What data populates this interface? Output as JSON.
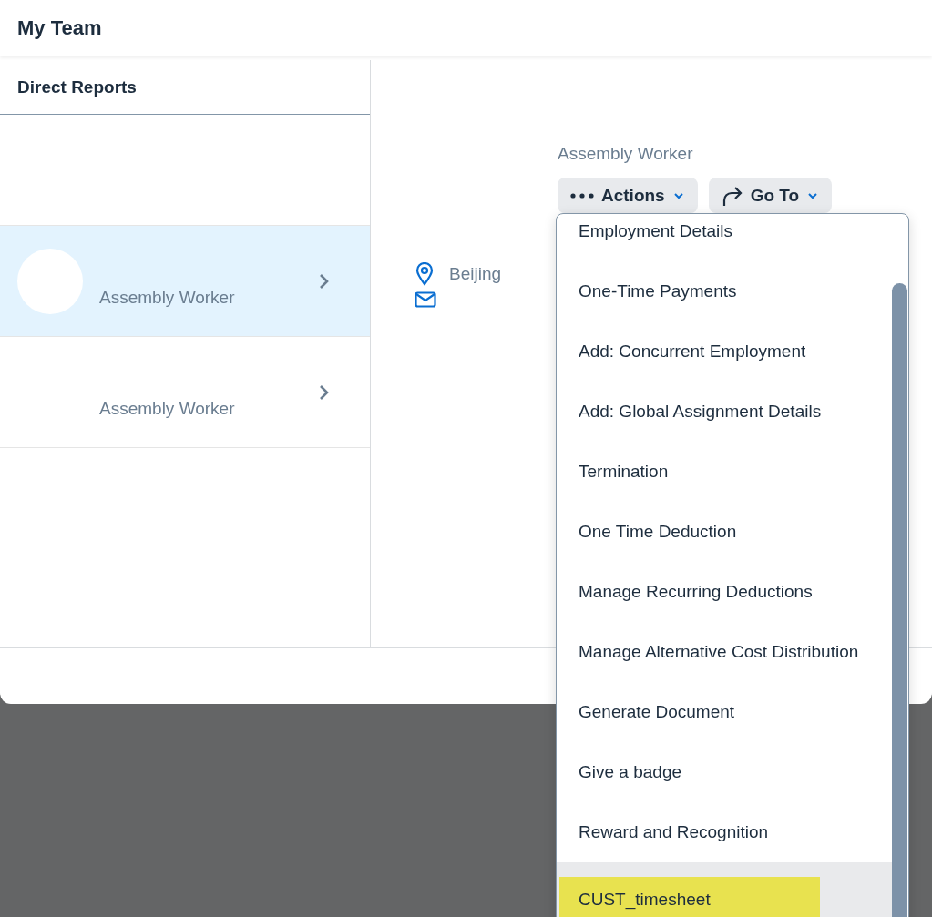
{
  "header": {
    "title": "My Team"
  },
  "sidebar": {
    "title": "Direct Reports",
    "items": [
      {
        "subtitle": "Assembly Worker",
        "selected": true
      },
      {
        "subtitle": "Assembly Worker",
        "selected": false
      }
    ]
  },
  "profile": {
    "subtitle": "Assembly Worker",
    "location": "Beijing",
    "buttons": [
      {
        "kind": "actions",
        "label": "Actions"
      },
      {
        "kind": "goto",
        "label": "Go To"
      }
    ]
  },
  "menu": {
    "items": [
      {
        "label": "Employment Details",
        "selected": false
      },
      {
        "label": "One-Time Payments",
        "selected": false
      },
      {
        "label": "Add: Concurrent Employment",
        "selected": false
      },
      {
        "label": "Add: Global Assignment Details",
        "selected": false
      },
      {
        "label": "Termination",
        "selected": false
      },
      {
        "label": "One Time Deduction",
        "selected": false
      },
      {
        "label": "Manage Recurring Deductions",
        "selected": false
      },
      {
        "label": "Manage Alternative Cost Distribution",
        "selected": false
      },
      {
        "label": "Generate Document",
        "selected": false
      },
      {
        "label": "Give a badge",
        "selected": false
      },
      {
        "label": "Reward and Recognition",
        "selected": false
      },
      {
        "label": "CUST_timesheet",
        "selected": true
      }
    ]
  }
}
